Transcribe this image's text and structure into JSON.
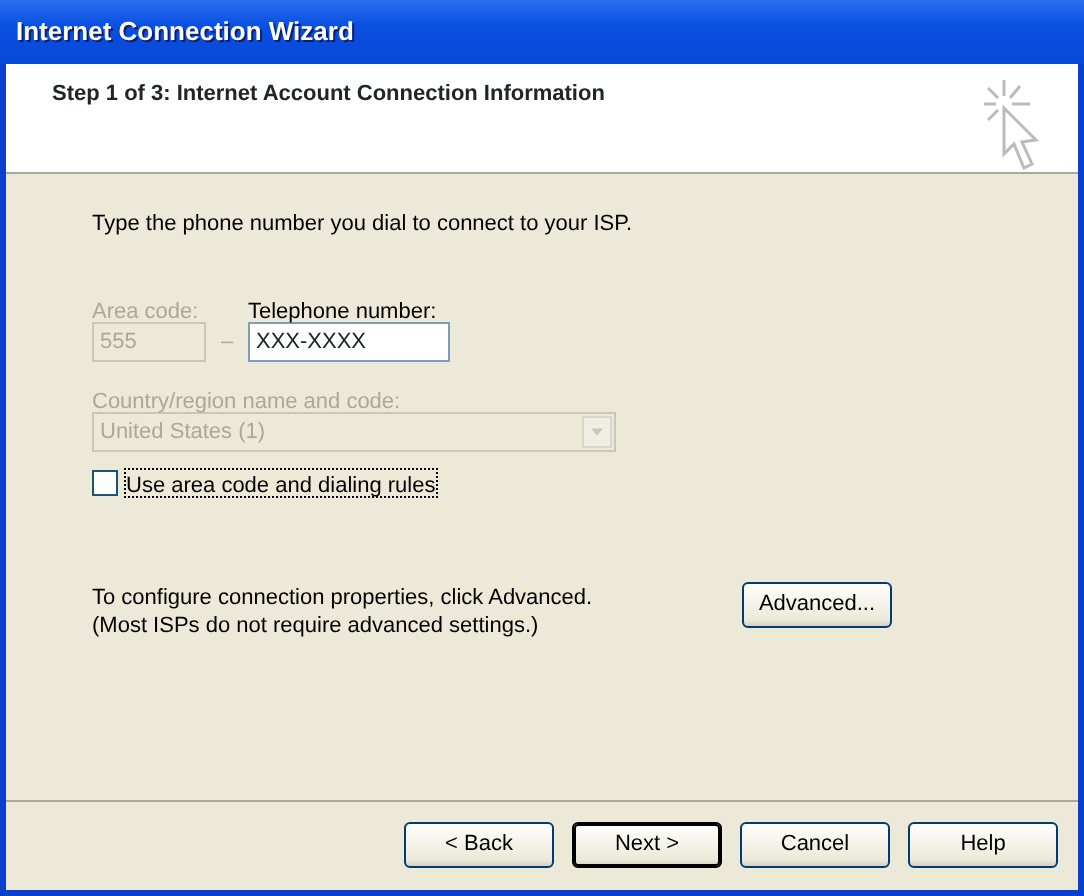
{
  "window": {
    "title": "Internet Connection Wizard"
  },
  "header": {
    "title": "Step 1 of 3: Internet Account Connection Information"
  },
  "instruction": "Type the phone number you dial to connect to your ISP.",
  "area_code": {
    "label": "Area code:",
    "value": "555",
    "disabled": true
  },
  "dash": {
    "text": "–",
    "disabled": true
  },
  "telephone": {
    "label": "Telephone number:",
    "value": "XXX-XXXX",
    "disabled": false
  },
  "country": {
    "label": "Country/region name and code:",
    "value": "United States (1)",
    "disabled": true
  },
  "dialing_rules": {
    "label": "Use area code and dialing rules",
    "checked": false,
    "focused": true
  },
  "advanced": {
    "lines": [
      "To configure connection properties, click Advanced.",
      "(Most ISPs do not require advanced settings.)"
    ],
    "button": "Advanced..."
  },
  "buttons": [
    {
      "label": "< Back",
      "default": false
    },
    {
      "label": "Next >",
      "default": true
    },
    {
      "label": "Cancel",
      "default": false
    },
    {
      "label": "Help",
      "default": false
    }
  ]
}
